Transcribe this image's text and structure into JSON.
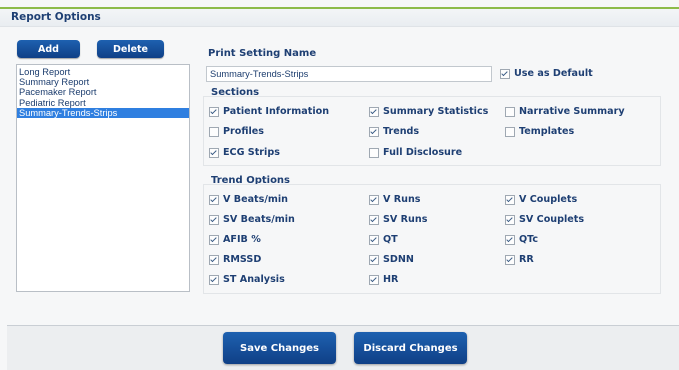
{
  "header": {
    "title": "Report Options"
  },
  "buttons": {
    "add": "Add",
    "delete": "Delete",
    "save": "Save Changes",
    "discard": "Discard Changes"
  },
  "reports": [
    {
      "label": "Long Report",
      "selected": false
    },
    {
      "label": "Summary Report",
      "selected": false
    },
    {
      "label": "Pacemaker Report",
      "selected": false
    },
    {
      "label": "Pediatric Report",
      "selected": false
    },
    {
      "label": "Summary-Trends-Strips",
      "selected": true
    }
  ],
  "print_setting": {
    "label": "Print Setting Name",
    "value": "Summary-Trends-Strips",
    "use_default_label": "Use as Default",
    "use_default_checked": true
  },
  "sections": {
    "title": "Sections",
    "items": [
      {
        "label": "Patient Information",
        "checked": true
      },
      {
        "label": "Summary Statistics",
        "checked": true
      },
      {
        "label": "Narrative Summary",
        "checked": false
      },
      {
        "label": "Profiles",
        "checked": false
      },
      {
        "label": "Trends",
        "checked": true
      },
      {
        "label": "Templates",
        "checked": false
      },
      {
        "label": "ECG Strips",
        "checked": true
      },
      {
        "label": "Full Disclosure",
        "checked": false
      }
    ]
  },
  "trend_options": {
    "title": "Trend Options",
    "items": [
      {
        "label": "V Beats/min",
        "checked": true
      },
      {
        "label": "V Runs",
        "checked": true
      },
      {
        "label": "V Couplets",
        "checked": true
      },
      {
        "label": "SV Beats/min",
        "checked": true
      },
      {
        "label": "SV Runs",
        "checked": true
      },
      {
        "label": "SV Couplets",
        "checked": true
      },
      {
        "label": "AFIB %",
        "checked": true
      },
      {
        "label": "QT",
        "checked": true
      },
      {
        "label": "QTc",
        "checked": true
      },
      {
        "label": "RMSSD",
        "checked": true
      },
      {
        "label": "SDNN",
        "checked": true
      },
      {
        "label": "RR",
        "checked": true
      },
      {
        "label": "ST Analysis",
        "checked": true
      },
      {
        "label": "HR",
        "checked": true
      }
    ]
  },
  "colors": {
    "accent_line": "#8dbb4a",
    "button": "#1a539e",
    "selection": "#2f7fe0",
    "text": "#1e3f73"
  }
}
